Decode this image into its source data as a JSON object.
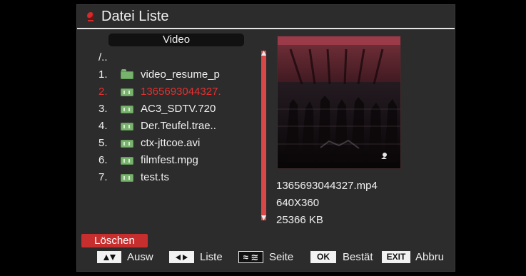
{
  "window": {
    "title": "Datei Liste"
  },
  "folder": {
    "label": "Video"
  },
  "files": [
    {
      "number": "",
      "name": "/..",
      "type": "parent"
    },
    {
      "number": "1.",
      "name": "video_resume_p",
      "type": "folder"
    },
    {
      "number": "2.",
      "name": "1365693044327.",
      "type": "video",
      "selected": true
    },
    {
      "number": "3.",
      "name": "AC3_SDTV.720",
      "type": "video"
    },
    {
      "number": "4.",
      "name": "Der.Teufel.trae..",
      "type": "video"
    },
    {
      "number": "5.",
      "name": "ctx-jttcoe.avi",
      "type": "video"
    },
    {
      "number": "6.",
      "name": "filmfest.mpg",
      "type": "video"
    },
    {
      "number": "7.",
      "name": "test.ts",
      "type": "video"
    }
  ],
  "preview": {
    "filename": "1365693044327.mp4",
    "resolution": "640X360",
    "size": "25366 KB"
  },
  "actions": {
    "delete_label": "Löschen"
  },
  "footer": {
    "select_label": "Ausw",
    "list_label": "Liste",
    "page_label": "Seite",
    "ok_key": "OK",
    "confirm_label": "Bestät",
    "exit_key": "EXIT",
    "cancel_label": "Abbru"
  },
  "colors": {
    "selected_text": "#e03131",
    "delete_button": "#c72f2f",
    "scrollbar": "#d84848",
    "video_icon": "#79b36f"
  },
  "icons": {
    "title": "folder-icon",
    "file": "video-file-icon",
    "folder": "folder-icon",
    "navigation": [
      "up-down-arrows-icon",
      "left-right-arrows-icon",
      "double-chevron-icon"
    ]
  }
}
